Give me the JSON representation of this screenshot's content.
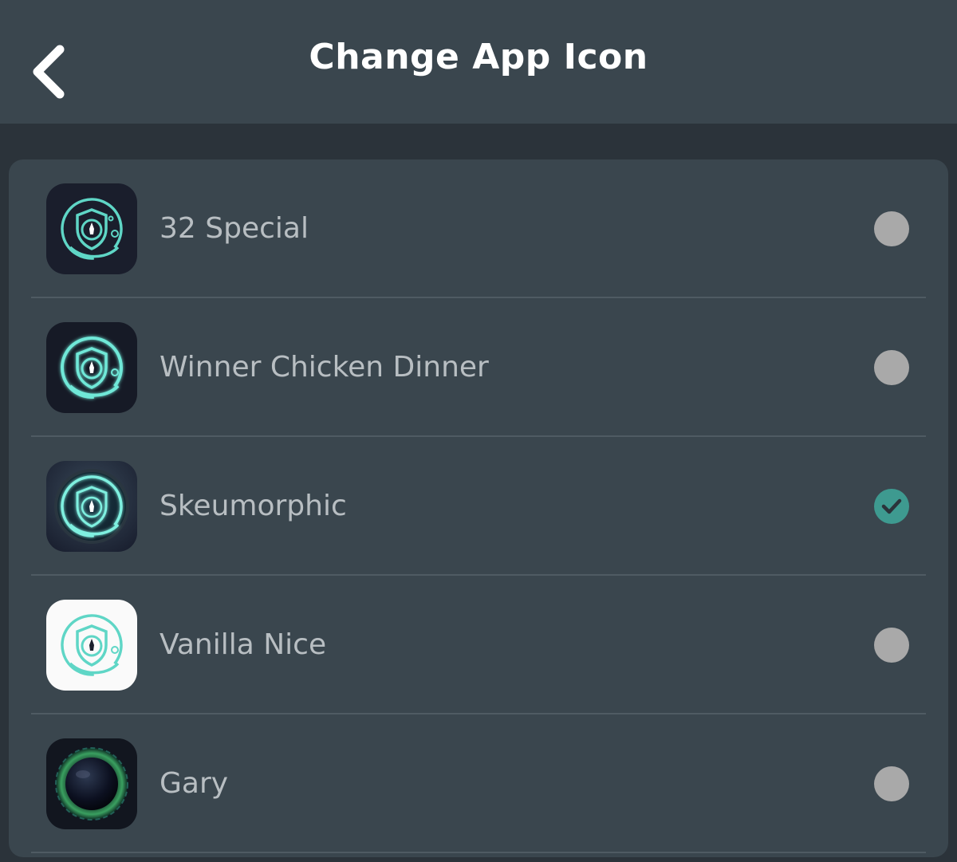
{
  "header": {
    "title": "Change App Icon",
    "back_icon": "chevron-left-icon"
  },
  "colors": {
    "header_bg": "#3a464e",
    "page_bg": "#2b333a",
    "card_bg": "#3a464e",
    "accent_teal": "#3e9a90",
    "radio_unselected": "#a9a9a9",
    "label_text": "#b8bec2"
  },
  "icons": {
    "items": [
      {
        "label": "32 Special",
        "icon": "32-special-icon",
        "selected": false
      },
      {
        "label": "Winner Chicken Dinner",
        "icon": "winner-chicken-dinner-icon",
        "selected": false
      },
      {
        "label": "Skeumorphic",
        "icon": "skeumorphic-icon",
        "selected": true
      },
      {
        "label": "Vanilla Nice",
        "icon": "vanilla-nice-icon",
        "selected": false
      },
      {
        "label": "Gary",
        "icon": "gary-icon",
        "selected": false
      }
    ]
  }
}
